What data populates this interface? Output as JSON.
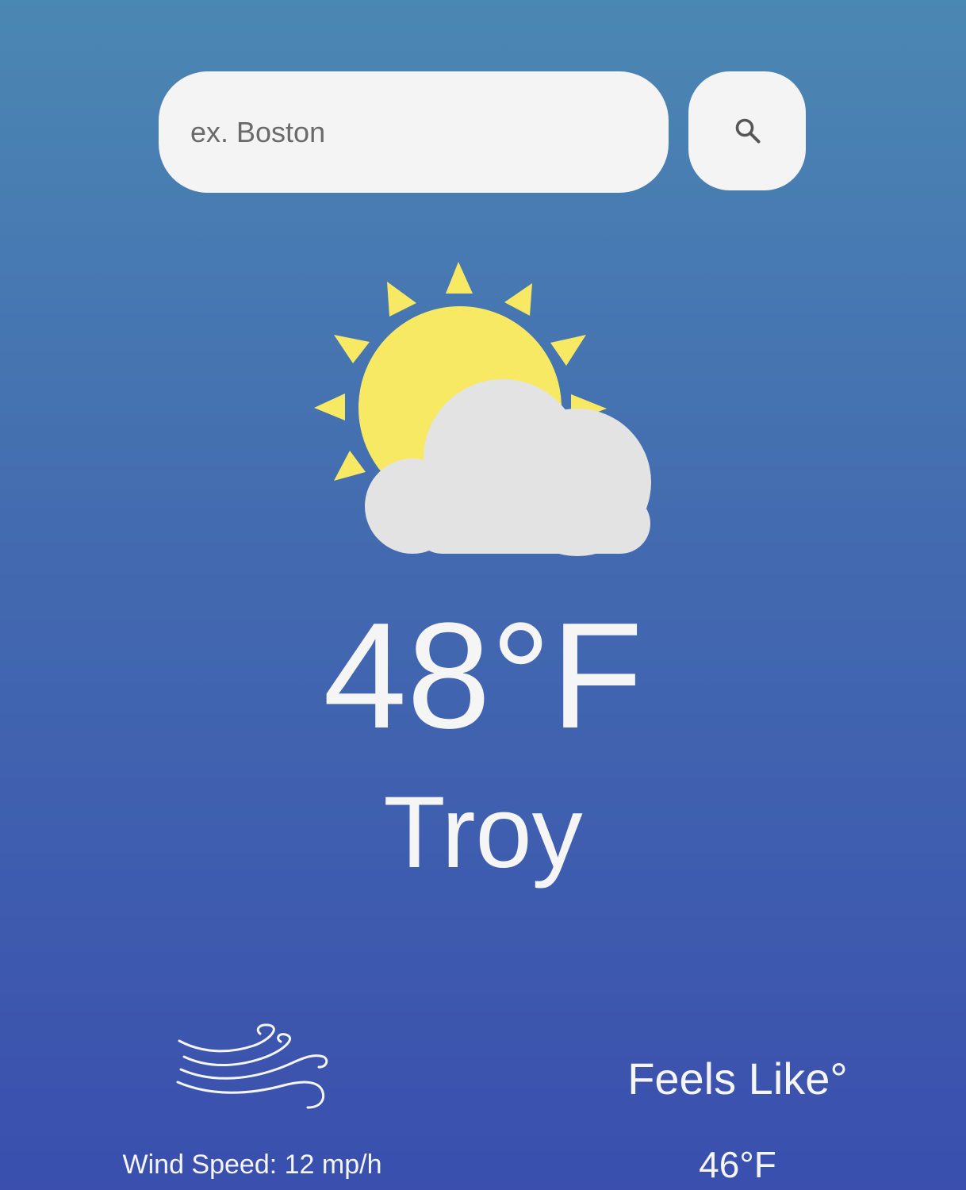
{
  "search": {
    "placeholder": "ex. Boston",
    "value": "",
    "button_icon": "search-icon"
  },
  "weather": {
    "icon": "partly-cloudy-icon",
    "temperature": "48°F",
    "city": "Troy"
  },
  "details": {
    "wind_icon": "wind-icon",
    "wind_label": "Wind Speed: 12 mp/h",
    "feels_like_label": "Feels Like°",
    "feels_like_value": "46°F"
  },
  "colors": {
    "background_top": "#4b87b3",
    "background_bottom": "#3a4fae",
    "sun": "#f8e964",
    "cloud": "#e3e3e3",
    "search_background": "#f4f4f4",
    "text": "#f5f5f5"
  }
}
